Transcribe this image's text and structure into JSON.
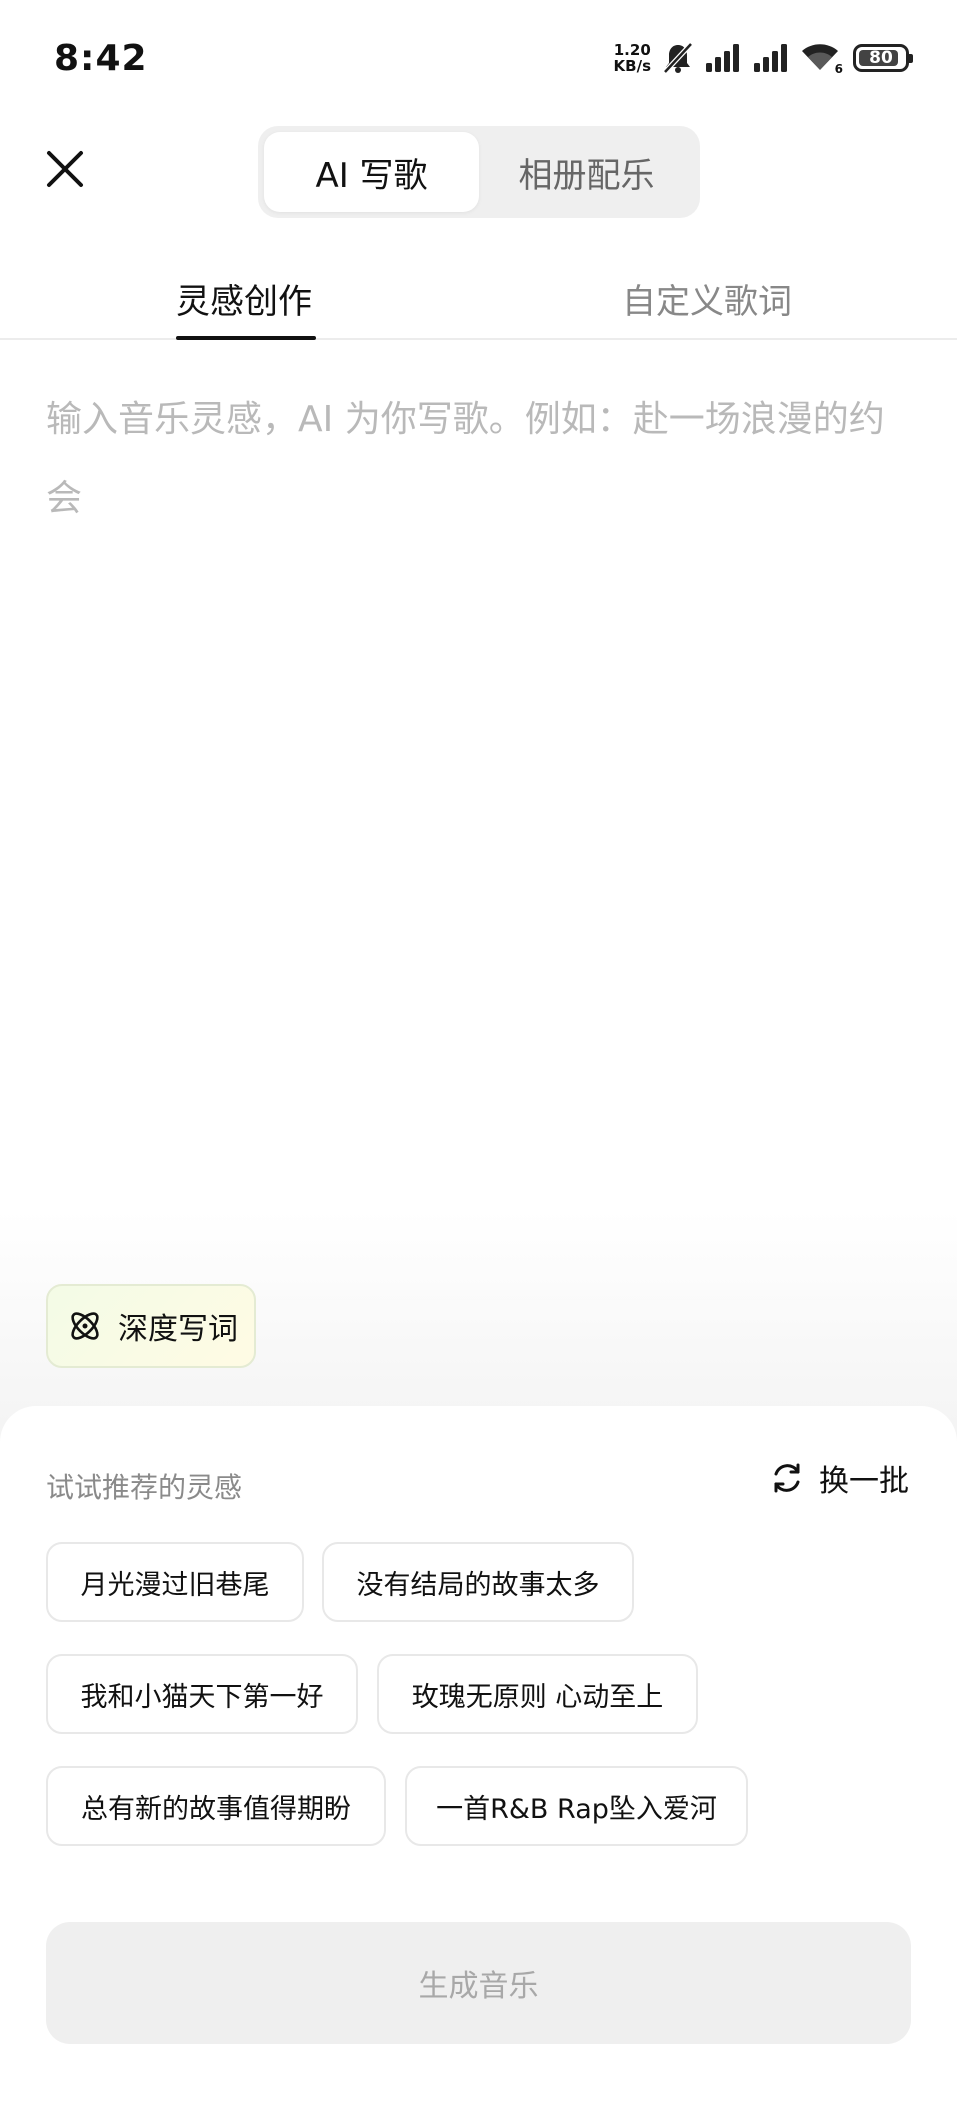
{
  "status_bar": {
    "time": "8:42",
    "net_speed_value": "1.20",
    "net_speed_unit": "KB/s",
    "wifi_badge": "6",
    "battery": "80",
    "icons": [
      "mute-bell-icon",
      "signal-icon",
      "signal-icon",
      "wifi-icon",
      "battery-icon"
    ]
  },
  "header": {
    "close_icon": "close-icon",
    "segments": [
      {
        "label": "AI 写歌",
        "active": true
      },
      {
        "label": "相册配乐",
        "active": false
      }
    ]
  },
  "tabs": [
    {
      "label": "灵感创作",
      "active": true
    },
    {
      "label": "自定义歌词",
      "active": false
    }
  ],
  "prompt": {
    "value": "",
    "placeholder": "输入音乐灵感，AI 为你写歌。例如：赴一场浪漫的约会"
  },
  "deep_write": {
    "label": "深度写词",
    "icon": "atom-icon"
  },
  "suggestions": {
    "title": "试试推荐的灵感",
    "refresh_label": "换一批",
    "refresh_icon": "refresh-icon",
    "items": [
      "月光漫过旧巷尾",
      "没有结局的故事太多",
      "我和小猫天下第一好",
      "玫瑰无原则 心动至上",
      "总有新的故事值得期盼",
      "一首R&B Rap坠入爱河"
    ]
  },
  "generate_button": {
    "label": "生成音乐",
    "enabled": false
  },
  "colors": {
    "text_primary": "#111111",
    "text_muted": "#8a8a8a",
    "placeholder": "#b9b9b9",
    "disabled_button_bg": "#efefef"
  }
}
